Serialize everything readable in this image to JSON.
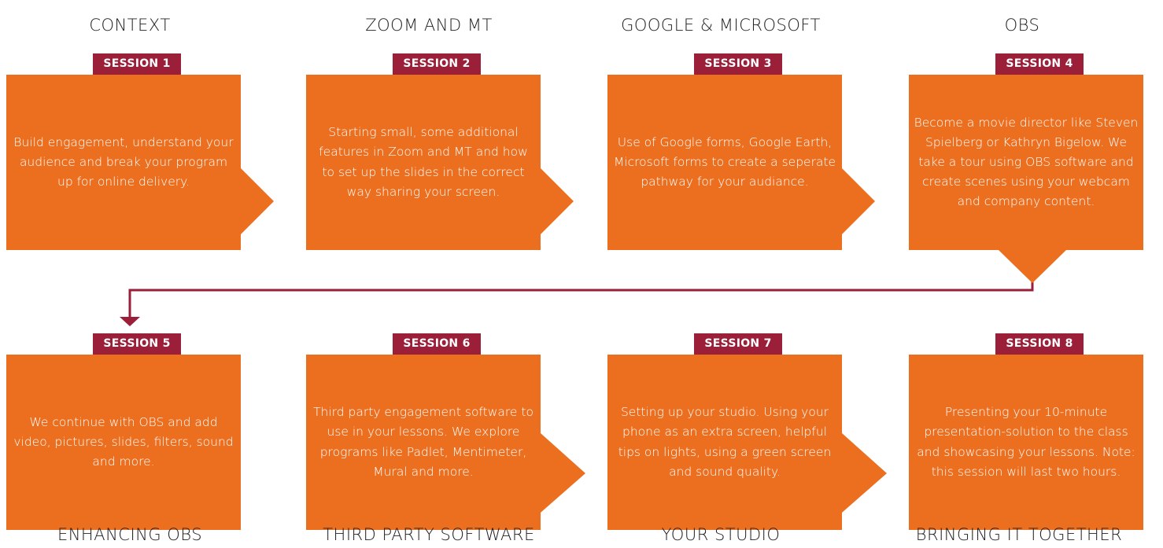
{
  "colors": {
    "card": "#ec6f20",
    "badge": "#9c1f3a",
    "connector": "#9c1f3a",
    "title": "#222222"
  },
  "sessions": [
    {
      "title": "CONTEXT",
      "badge": "SESSION 1",
      "text": "Build engagement, understand your audience and break your program up for online delivery."
    },
    {
      "title": "ZOOM AND MT",
      "badge": "SESSION 2",
      "text": "Starting small, some additional features in Zoom and MT and how to set up the slides in the correct way sharing your screen."
    },
    {
      "title": "GOOGLE & MICROSOFT",
      "badge": "SESSION 3",
      "text": "Use of Google forms, Google Earth, Microsoft forms to create a seperate pathway for your audiance."
    },
    {
      "title": "OBS",
      "badge": "SESSION 4",
      "text": "Become a movie director like Steven Spielberg or Kathryn Bigelow. We take a tour using OBS software and create scenes using your webcam and company content."
    },
    {
      "title": "ENHANCING OBS",
      "badge": "SESSION 5",
      "text": "We continue with OBS and add video, pictures, slides, filters, sound and more."
    },
    {
      "title": "THIRD PARTY SOFTWARE",
      "badge": "SESSION 6",
      "text": "Third party engagement software to use in your lessons. We explore programs like Padlet, Mentimeter, Mural and more."
    },
    {
      "title": "YOUR STUDIO",
      "badge": "SESSION 7",
      "text": "Setting up your studio. Using your phone as an extra screen, helpful tips on lights, using a green screen and sound quality."
    },
    {
      "title": "BRINGING IT TOGETHER",
      "badge": "SESSION 8",
      "text": "Presenting your 10-minute presentation-solution to the class and showcasing your lessons. Note: this session will last two hours."
    }
  ]
}
